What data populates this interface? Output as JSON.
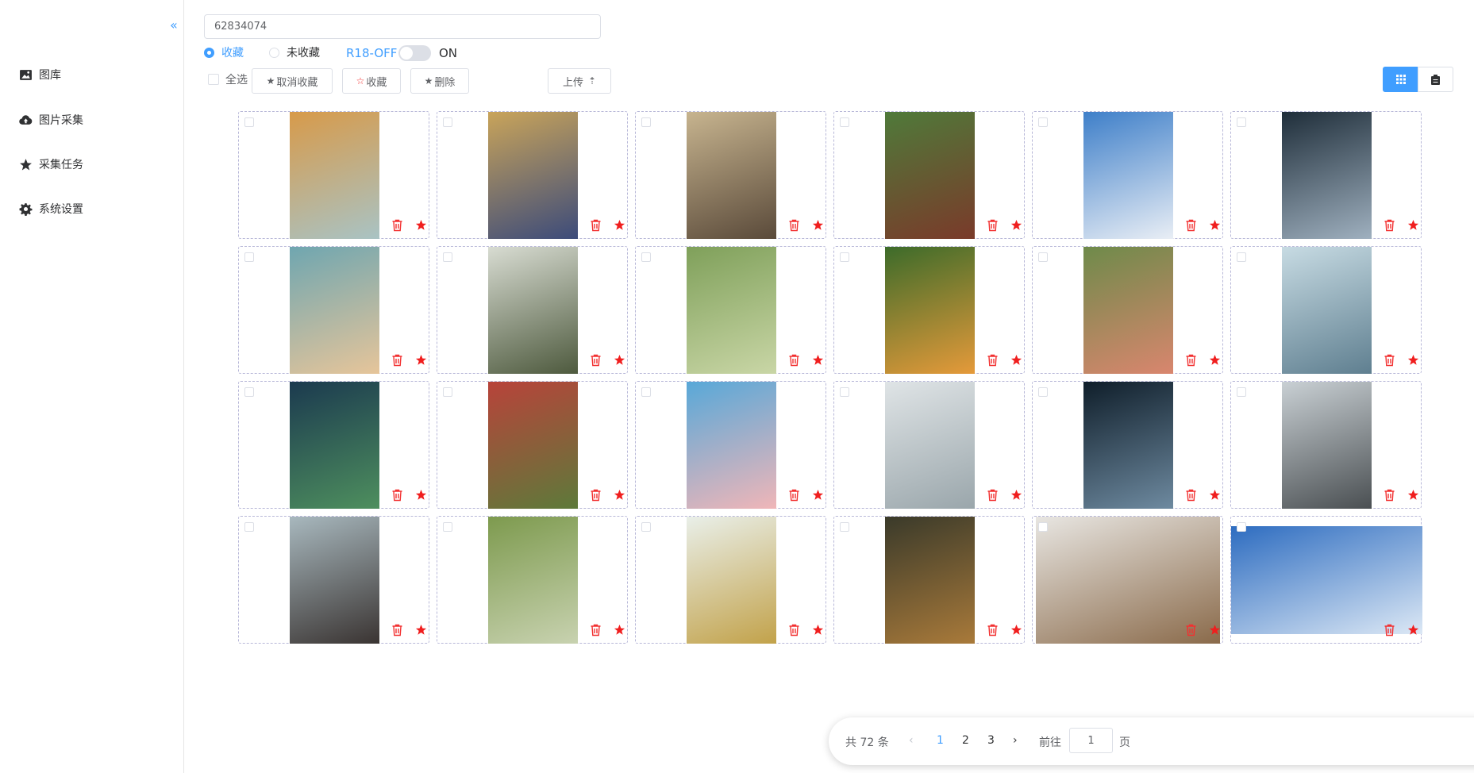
{
  "sidebar": {
    "items": [
      {
        "label": "图库",
        "icon": "image-icon"
      },
      {
        "label": "图片采集",
        "icon": "cloud-upload-icon"
      },
      {
        "label": "采集任务",
        "icon": "star-icon"
      },
      {
        "label": "系统设置",
        "icon": "gear-icon"
      }
    ]
  },
  "search": {
    "value": "62834074"
  },
  "filter": {
    "favorited": "收藏",
    "not_favorited": "未收藏",
    "selected": "收藏",
    "r18_off": "R18-OFF",
    "r18_on": "ON"
  },
  "toolbar": {
    "select_all": "全选",
    "unfavorite": "取消收藏",
    "favorite": "收藏",
    "delete": "删除",
    "upload": "上传"
  },
  "pagination": {
    "total": "共 72 条",
    "pages": [
      "1",
      "2",
      "3"
    ],
    "current": "1",
    "goto_label": "前往",
    "goto_value": "1",
    "page_suffix": "页"
  },
  "colors": {
    "accent": "#409eff",
    "danger": "#f23030"
  }
}
